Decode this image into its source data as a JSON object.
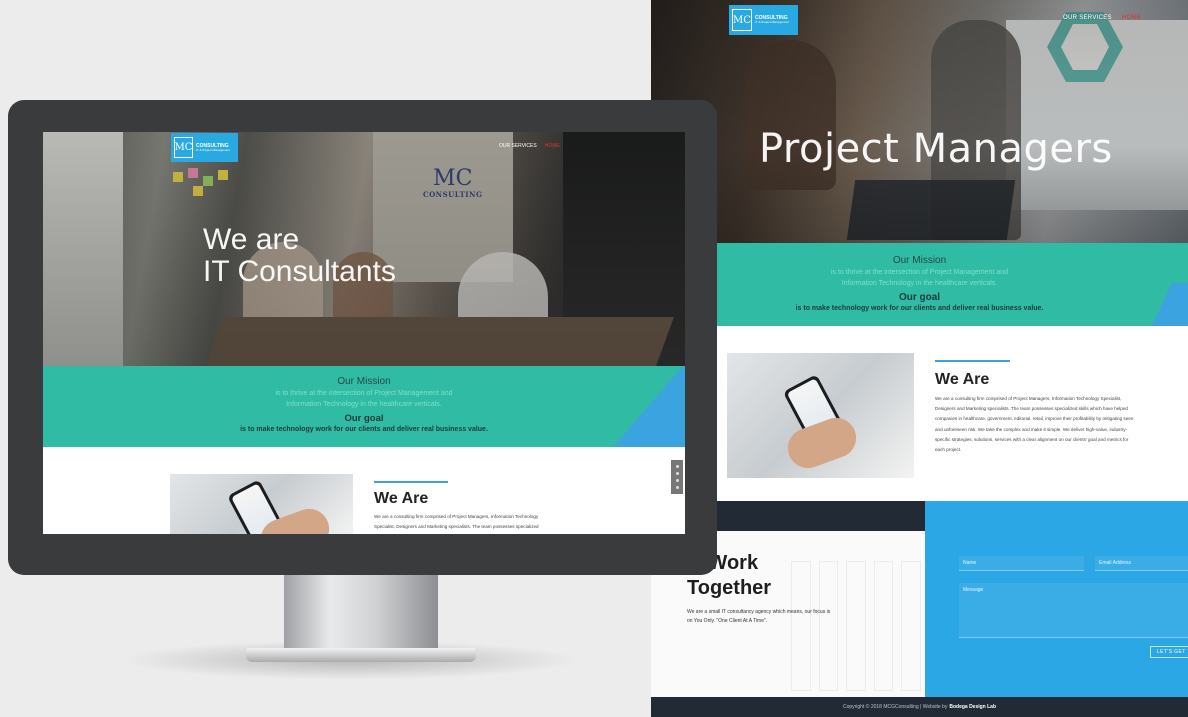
{
  "brand": {
    "logo_mark": "MC",
    "logo_name": "CONSULTING",
    "logo_tagline": "IT & Project Management",
    "wall_mark": "MC",
    "wall_name": "CONSULTING"
  },
  "nav": {
    "services": "OUR SERVICES",
    "home": "HOME"
  },
  "page_hero": {
    "title": "Project Managers"
  },
  "screen_hero": {
    "title_line1": "We are",
    "title_line2": "IT Consultants"
  },
  "mission": {
    "heading": "Our Mission",
    "text_line1": "is to thrive at the intersection of Project Management and",
    "text_line2": "Information Technology in the healthcare verticals.",
    "goal_heading": "Our goal",
    "goal_text": "is to make technology work for our clients and deliver real business value."
  },
  "about": {
    "heading": "We Are",
    "body": "We are a consulting firm comprised of Project Managers, Information Technology Specialist, Designers and Marketing specialists. The team possesses specialized skills which have helped companies in healthcare, government, editorial, retail, improve their profitability by mitigating seen and unforeseen risk. We take the complex and make it simple. We deliver high-value, industry-specific strategies, solutions, services with a clear alignment on our clients' goal and metrics for each project.",
    "body_short": "We are a consulting firm comprised of Project Managers, Information Technology Specialist, Designers and Marketing specialists. The team possesses specialized"
  },
  "contact": {
    "heading_line1": "'s Work",
    "heading_line2": "Together",
    "text": "We are a small  IT consultancy agency which means, our focus is on You Only. \"One Client At A Time\".",
    "name_placeholder": "Name",
    "email_placeholder": "Email Address",
    "message_placeholder": "Message",
    "submit_label": "LET'S GET T"
  },
  "footer": {
    "text": "Copyright © 2018 MCGConsulting  |  Website by",
    "credit": "Bodega Design Lab"
  },
  "colors": {
    "teal": "#30bca4",
    "blue": "#2aa7e4",
    "navy": "#222b35",
    "accent_red": "#e1322b"
  }
}
